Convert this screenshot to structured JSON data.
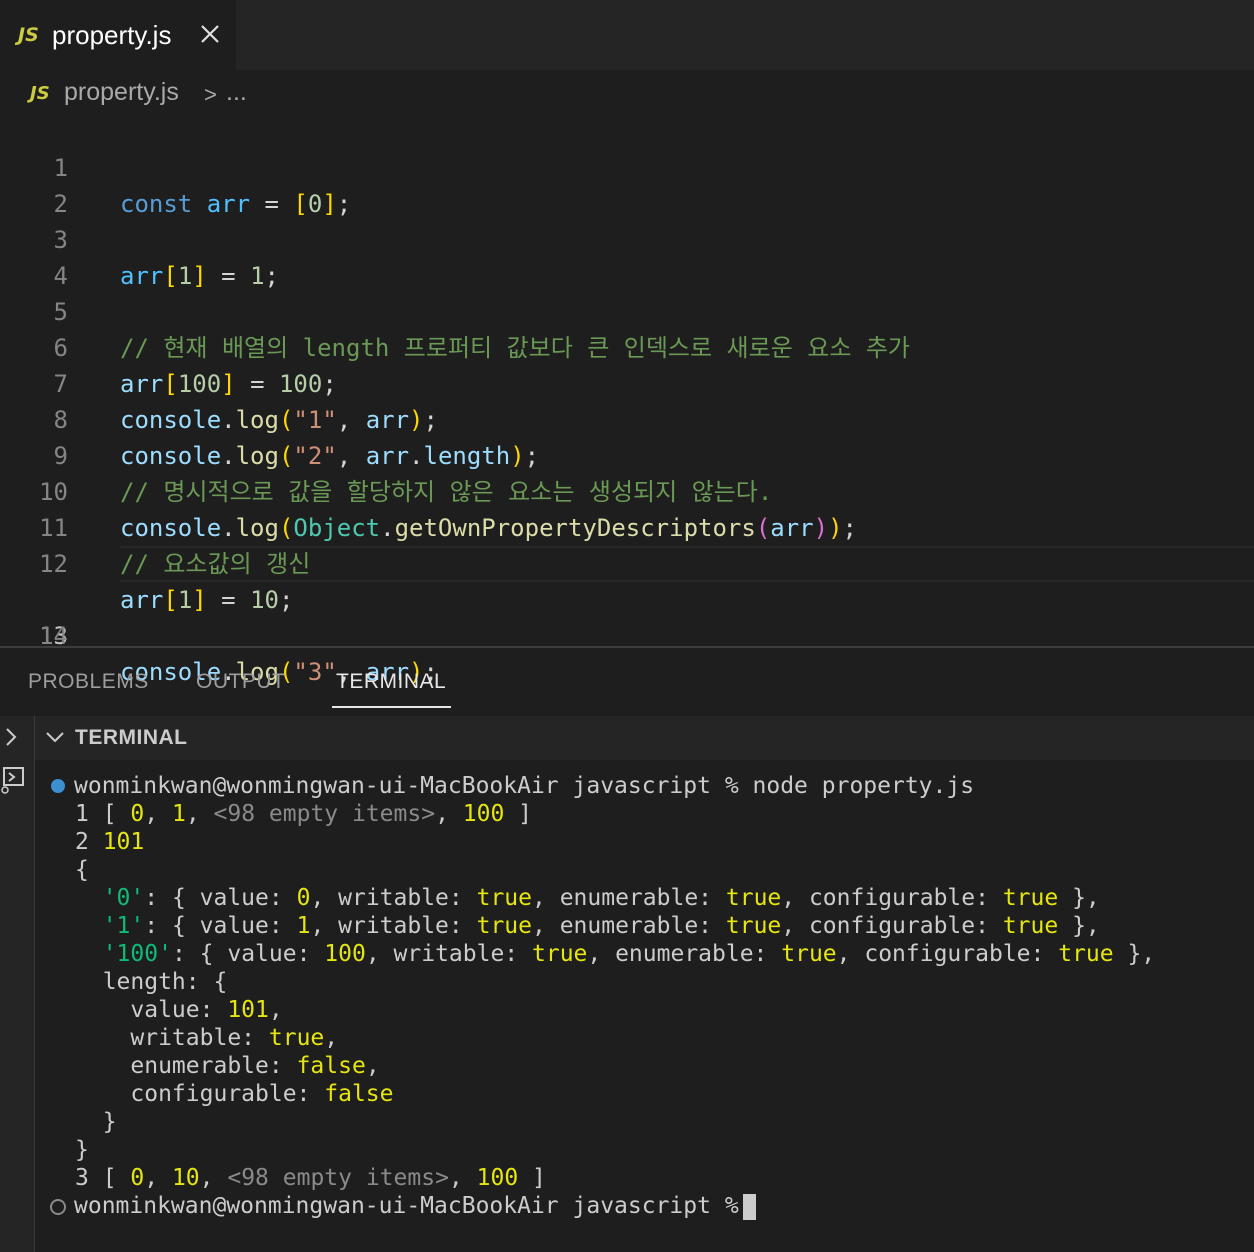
{
  "tab": {
    "lang_badge": "JS",
    "title": "property.js"
  },
  "breadcrumb": {
    "lang_badge": "JS",
    "file": "property.js",
    "separator": ">",
    "more": "..."
  },
  "editor": {
    "line_numbers": [
      "1",
      "2",
      "3",
      "4",
      "5",
      "6",
      "7",
      "8",
      "9",
      "10",
      "11",
      "12",
      "13",
      "14"
    ],
    "current_line": 13
  },
  "panel": {
    "tabs": {
      "problems": "PROBLEMS",
      "output": "OUTPUT",
      "terminal": "TERMINAL"
    },
    "terminal_header": "TERMINAL",
    "prompt_1": "wonminkwan@wonmingwan-ui-MacBookAir javascript % node property.js",
    "prompt_2": "wonminkwan@wonmingwan-ui-MacBookAir javascript %"
  },
  "colors": {
    "badge": "#cbcb41",
    "accent": "#3d8fd1",
    "background": "#1e1e1e"
  },
  "icons": [
    "close-icon",
    "chevron-right-icon",
    "chevron-down-icon",
    "terminal-icon"
  ]
}
